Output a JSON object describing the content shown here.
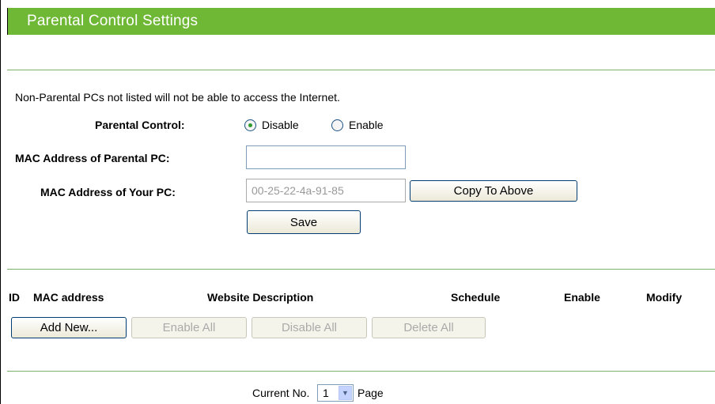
{
  "title": "Parental Control Settings",
  "notice": "Non-Parental PCs not listed will not be able to access the Internet.",
  "parental_control": {
    "label": "Parental Control:",
    "options": [
      "Disable",
      "Enable"
    ],
    "selected": "Disable"
  },
  "mac_parental": {
    "label": "MAC Address of Parental PC:",
    "value": ""
  },
  "mac_yours": {
    "label": "MAC Address of Your PC:",
    "value": "00-25-22-4a-91-85"
  },
  "buttons": {
    "copy": "Copy To Above",
    "save": "Save",
    "add_new": "Add New...",
    "enable_all": "Enable All",
    "disable_all": "Disable All",
    "delete_all": "Delete All"
  },
  "table": {
    "headers": [
      "ID",
      "MAC address",
      "Website Description",
      "Schedule",
      "Enable",
      "Modify"
    ]
  },
  "pager": {
    "prefix": "Current No.",
    "value": "1",
    "suffix": "Page"
  },
  "colors": {
    "title_bar": "#6eb835",
    "divider": "#7fb069"
  }
}
